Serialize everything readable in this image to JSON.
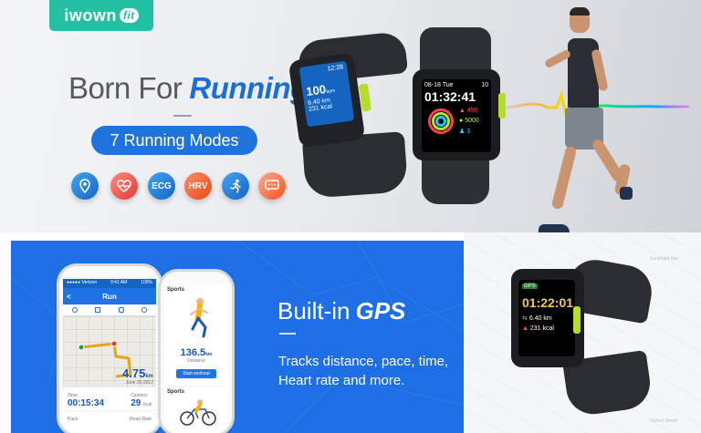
{
  "brand": {
    "logo_main": "iwown",
    "logo_suffix": "fit",
    "color": "#22c1a4"
  },
  "hero": {
    "headline_part1": "Born For",
    "headline_part2": "Running",
    "modes_pill": "7 Running Modes",
    "accent_color": "#1f73dc",
    "features": [
      {
        "icon": "location-pin-icon",
        "label": "",
        "color": "#1e88e5"
      },
      {
        "icon": "heart-rate-icon",
        "label": "",
        "color": "#ef5350"
      },
      {
        "icon": "ecg-icon",
        "label": "ECG",
        "color": "#1e88e5"
      },
      {
        "icon": "hrv-icon",
        "label": "HRV",
        "color": "#f4511e"
      },
      {
        "icon": "running-icon",
        "label": "",
        "color": "#1e88e5"
      },
      {
        "icon": "message-icon",
        "label": "",
        "color": "#ff7043"
      }
    ]
  },
  "watch_front": {
    "date": "08-18 Tue",
    "clock": "10",
    "time": "01:32:41",
    "calories": "450",
    "steps": "5000",
    "stat3": "3"
  },
  "watch_side": {
    "clock": "12:28",
    "heart_rate": "100",
    "hr_unit": "bpm",
    "distance": "6.40 km",
    "calories": "231 kcal"
  },
  "gps": {
    "title_part1": "Built-in",
    "title_part2": "GPS",
    "desc_line1": "Tracks distance, pace, time,",
    "desc_line2": "Heart rate and more."
  },
  "phone_run": {
    "status_left": "●●●●● Verizon",
    "status_time": "9:41 AM",
    "status_right": "100%",
    "back": "<",
    "title": "Run",
    "distance": "4.75",
    "distance_unit": "km",
    "date": "June 20,2017",
    "time_label": "Time",
    "time_value": "00:15:34",
    "calories_label": "Calories",
    "calories_value": "29",
    "calories_unit": "kcal",
    "pace_label": "Pace",
    "hr_label": "Heart Rate"
  },
  "phone_sports": {
    "title": "Sports",
    "distance_value": "136.5",
    "distance_unit": "km",
    "distance_label": "Distance",
    "start_button": "Start workout",
    "title2": "Sports"
  },
  "watch_gps": {
    "status": "GPS",
    "time": "01:22:01",
    "distance": "6.40 km",
    "calories": "231 kcal"
  },
  "map_notes": {
    "top": "Sunbright Ave",
    "bottom": "Oxford Street"
  }
}
